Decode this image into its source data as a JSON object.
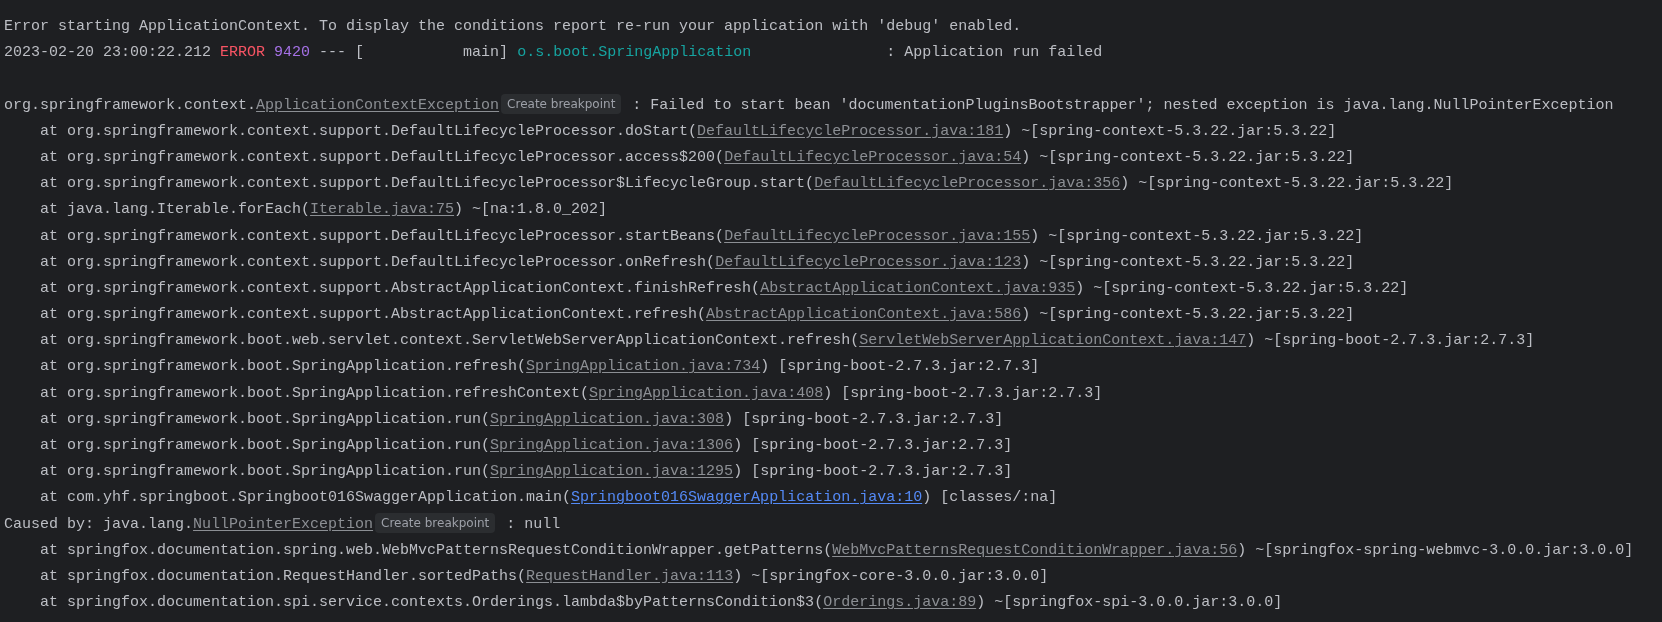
{
  "console": {
    "lines": [
      {
        "kind": "text",
        "segments": [
          {
            "kind": "text",
            "text": "Error starting ApplicationContext. To display the conditions report re-run your application with 'debug' enabled."
          }
        ]
      },
      {
        "kind": "text",
        "segments": [
          {
            "kind": "text",
            "text": "2023-02-20 23:00:22.212 "
          },
          {
            "kind": "error",
            "text": "ERROR"
          },
          {
            "kind": "pid",
            "text": " 9420"
          },
          {
            "kind": "text",
            "text": " --- [           main] "
          },
          {
            "kind": "logger",
            "text": "o.s.boot.SpringApplication"
          },
          {
            "kind": "text",
            "text": "               : Application run failed"
          }
        ]
      },
      {
        "kind": "blank"
      },
      {
        "kind": "text",
        "segments": [
          {
            "kind": "text",
            "text": "org.springframework.context."
          },
          {
            "kind": "link",
            "text": "ApplicationContextException"
          },
          {
            "kind": "hint",
            "text": "Create breakpoint"
          },
          {
            "kind": "text",
            "text": " : Failed to start bean 'documentationPluginsBootstrapper'; nested exception is java.lang.NullPointerException"
          }
        ]
      },
      {
        "kind": "frame",
        "segments": [
          {
            "kind": "text",
            "text": "at org.springframework.context.support.DefaultLifecycleProcessor.doStart("
          },
          {
            "kind": "link",
            "text": "DefaultLifecycleProcessor.java:181"
          },
          {
            "kind": "text",
            "text": ") ~[spring-context-5.3.22.jar:5.3.22]"
          }
        ]
      },
      {
        "kind": "frame",
        "segments": [
          {
            "kind": "text",
            "text": "at org.springframework.context.support.DefaultLifecycleProcessor.access$200("
          },
          {
            "kind": "link",
            "text": "DefaultLifecycleProcessor.java:54"
          },
          {
            "kind": "text",
            "text": ") ~[spring-context-5.3.22.jar:5.3.22]"
          }
        ]
      },
      {
        "kind": "frame",
        "segments": [
          {
            "kind": "text",
            "text": "at org.springframework.context.support.DefaultLifecycleProcessor$LifecycleGroup.start("
          },
          {
            "kind": "link",
            "text": "DefaultLifecycleProcessor.java:356"
          },
          {
            "kind": "text",
            "text": ") ~[spring-context-5.3.22.jar:5.3.22]"
          }
        ]
      },
      {
        "kind": "frame",
        "segments": [
          {
            "kind": "text",
            "text": "at java.lang.Iterable.forEach("
          },
          {
            "kind": "link",
            "text": "Iterable.java:75"
          },
          {
            "kind": "text",
            "text": ") ~[na:1.8.0_202]"
          }
        ]
      },
      {
        "kind": "frame",
        "segments": [
          {
            "kind": "text",
            "text": "at org.springframework.context.support.DefaultLifecycleProcessor.startBeans("
          },
          {
            "kind": "link",
            "text": "DefaultLifecycleProcessor.java:155"
          },
          {
            "kind": "text",
            "text": ") ~[spring-context-5.3.22.jar:5.3.22]"
          }
        ]
      },
      {
        "kind": "frame",
        "segments": [
          {
            "kind": "text",
            "text": "at org.springframework.context.support.DefaultLifecycleProcessor.onRefresh("
          },
          {
            "kind": "link",
            "text": "DefaultLifecycleProcessor.java:123"
          },
          {
            "kind": "text",
            "text": ") ~[spring-context-5.3.22.jar:5.3.22]"
          }
        ]
      },
      {
        "kind": "frame",
        "segments": [
          {
            "kind": "text",
            "text": "at org.springframework.context.support.AbstractApplicationContext.finishRefresh("
          },
          {
            "kind": "link",
            "text": "AbstractApplicationContext.java:935"
          },
          {
            "kind": "text",
            "text": ") ~[spring-context-5.3.22.jar:5.3.22]"
          }
        ]
      },
      {
        "kind": "frame",
        "segments": [
          {
            "kind": "text",
            "text": "at org.springframework.context.support.AbstractApplicationContext.refresh("
          },
          {
            "kind": "link",
            "text": "AbstractApplicationContext.java:586"
          },
          {
            "kind": "text",
            "text": ") ~[spring-context-5.3.22.jar:5.3.22]"
          }
        ]
      },
      {
        "kind": "frame",
        "segments": [
          {
            "kind": "text",
            "text": "at org.springframework.boot.web.servlet.context.ServletWebServerApplicationContext.refresh("
          },
          {
            "kind": "link",
            "text": "ServletWebServerApplicationContext.java:147"
          },
          {
            "kind": "text",
            "text": ") ~[spring-boot-2.7.3.jar:2.7.3]"
          }
        ]
      },
      {
        "kind": "frame",
        "segments": [
          {
            "kind": "text",
            "text": "at org.springframework.boot.SpringApplication.refresh("
          },
          {
            "kind": "link",
            "text": "SpringApplication.java:734"
          },
          {
            "kind": "text",
            "text": ") [spring-boot-2.7.3.jar:2.7.3]"
          }
        ]
      },
      {
        "kind": "frame",
        "segments": [
          {
            "kind": "text",
            "text": "at org.springframework.boot.SpringApplication.refreshContext("
          },
          {
            "kind": "link",
            "text": "SpringApplication.java:408"
          },
          {
            "kind": "text",
            "text": ") [spring-boot-2.7.3.jar:2.7.3]"
          }
        ]
      },
      {
        "kind": "frame",
        "segments": [
          {
            "kind": "text",
            "text": "at org.springframework.boot.SpringApplication.run("
          },
          {
            "kind": "link",
            "text": "SpringApplication.java:308"
          },
          {
            "kind": "text",
            "text": ") [spring-boot-2.7.3.jar:2.7.3]"
          }
        ]
      },
      {
        "kind": "frame",
        "segments": [
          {
            "kind": "text",
            "text": "at org.springframework.boot.SpringApplication.run("
          },
          {
            "kind": "link",
            "text": "SpringApplication.java:1306"
          },
          {
            "kind": "text",
            "text": ") [spring-boot-2.7.3.jar:2.7.3]"
          }
        ]
      },
      {
        "kind": "frame",
        "segments": [
          {
            "kind": "text",
            "text": "at org.springframework.boot.SpringApplication.run("
          },
          {
            "kind": "link",
            "text": "SpringApplication.java:1295"
          },
          {
            "kind": "text",
            "text": ") [spring-boot-2.7.3.jar:2.7.3]"
          }
        ]
      },
      {
        "kind": "frame",
        "segments": [
          {
            "kind": "text",
            "text": "at com.yhf.springboot.Springboot016SwaggerApplication.main("
          },
          {
            "kind": "app_link",
            "text": "Springboot016SwaggerApplication.java:10"
          },
          {
            "kind": "text",
            "text": ") [classes/:na]"
          }
        ]
      },
      {
        "kind": "text",
        "segments": [
          {
            "kind": "text",
            "text": "Caused by: java.lang."
          },
          {
            "kind": "link",
            "text": "NullPointerException"
          },
          {
            "kind": "hint",
            "text": "Create breakpoint"
          },
          {
            "kind": "text",
            "text": " : null"
          }
        ]
      },
      {
        "kind": "frame",
        "segments": [
          {
            "kind": "text",
            "text": "at springfox.documentation.spring.web.WebMvcPatternsRequestConditionWrapper.getPatterns("
          },
          {
            "kind": "link",
            "text": "WebMvcPatternsRequestConditionWrapper.java:56"
          },
          {
            "kind": "text",
            "text": ") ~[springfox-spring-webmvc-3.0.0.jar:3.0.0]"
          }
        ]
      },
      {
        "kind": "frame",
        "segments": [
          {
            "kind": "text",
            "text": "at springfox.documentation.RequestHandler.sortedPaths("
          },
          {
            "kind": "link",
            "text": "RequestHandler.java:113"
          },
          {
            "kind": "text",
            "text": ") ~[springfox-core-3.0.0.jar:3.0.0]"
          }
        ]
      },
      {
        "kind": "frame",
        "segments": [
          {
            "kind": "text",
            "text": "at springfox.documentation.spi.service.contexts.Orderings.lambda$byPatternsCondition$3("
          },
          {
            "kind": "link",
            "text": "Orderings.java:89"
          },
          {
            "kind": "text",
            "text": ") ~[springfox-spi-3.0.0.jar:3.0.0]"
          }
        ]
      }
    ]
  }
}
